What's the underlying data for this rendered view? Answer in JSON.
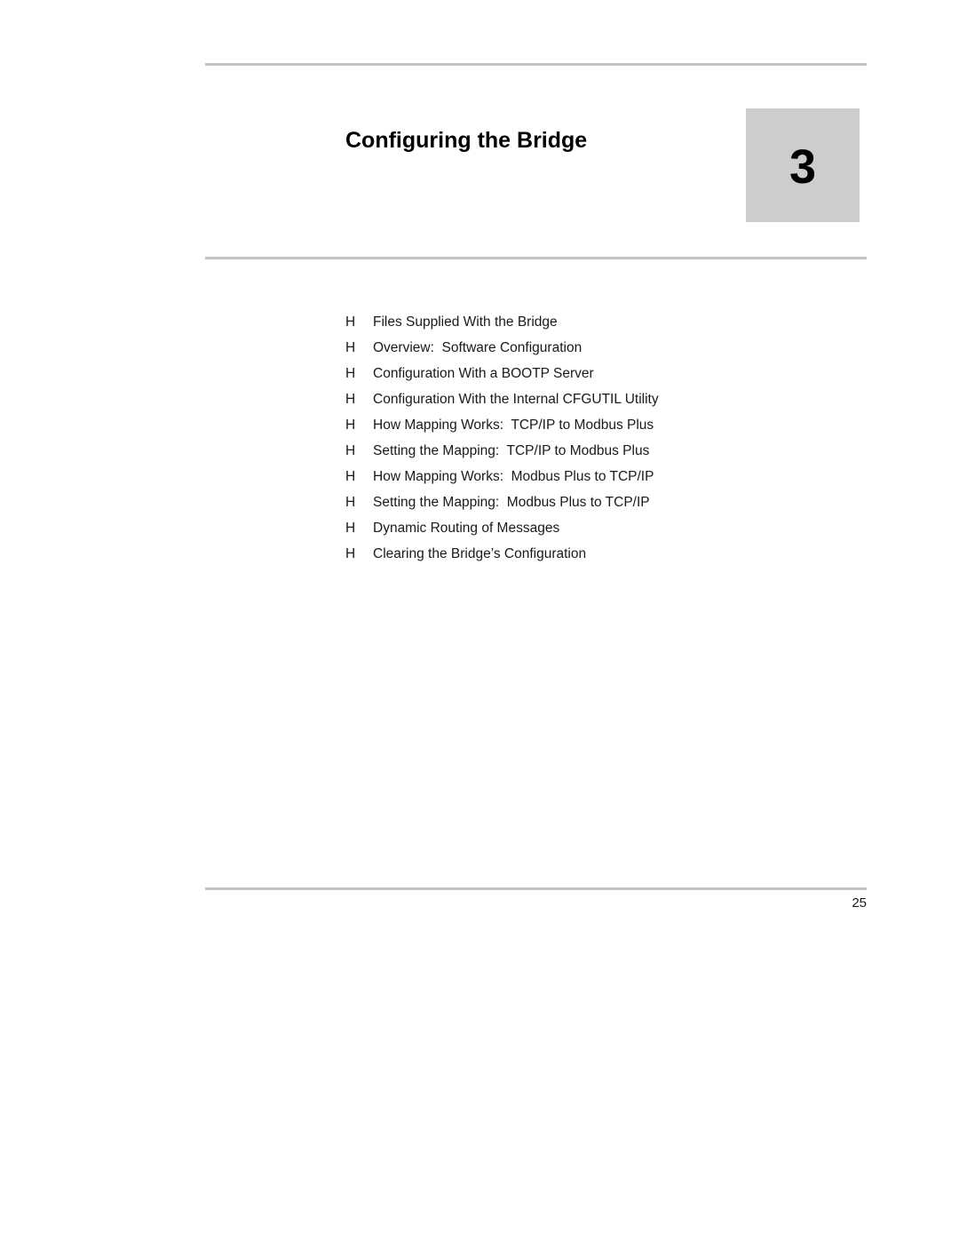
{
  "document": {
    "chapter_title": "Configuring the Bridge",
    "chapter_number": "3",
    "page_number": "25"
  },
  "contents": {
    "bullet_glyph": "H",
    "items": [
      {
        "bullet": "H",
        "label": "Files Supplied With the Bridge"
      },
      {
        "bullet": "H",
        "label": "Overview:  Software Configuration"
      },
      {
        "bullet": "H",
        "label": "Configuration With a BOOTP Server"
      },
      {
        "bullet": "H",
        "label": "Configuration With the Internal CFGUTIL Utility"
      },
      {
        "bullet": "H",
        "label": "How Mapping Works:  TCP/IP to Modbus Plus"
      },
      {
        "bullet": "H",
        "label": "Setting the Mapping:  TCP/IP to Modbus Plus"
      },
      {
        "bullet": "H",
        "label": "How Mapping Works:  Modbus Plus to TCP/IP"
      },
      {
        "bullet": "H",
        "label": "Setting the Mapping:  Modbus Plus to TCP/IP"
      },
      {
        "bullet": "H",
        "label": "Dynamic Routing of Messages"
      },
      {
        "bullet": "H",
        "label": "Clearing the Bridge’s Configuration"
      }
    ]
  },
  "colors": {
    "rule": "#c4c4c4",
    "chapter_box": "#cdcdcd",
    "text": "#1a1a1a",
    "page_background": "#ffffff"
  }
}
